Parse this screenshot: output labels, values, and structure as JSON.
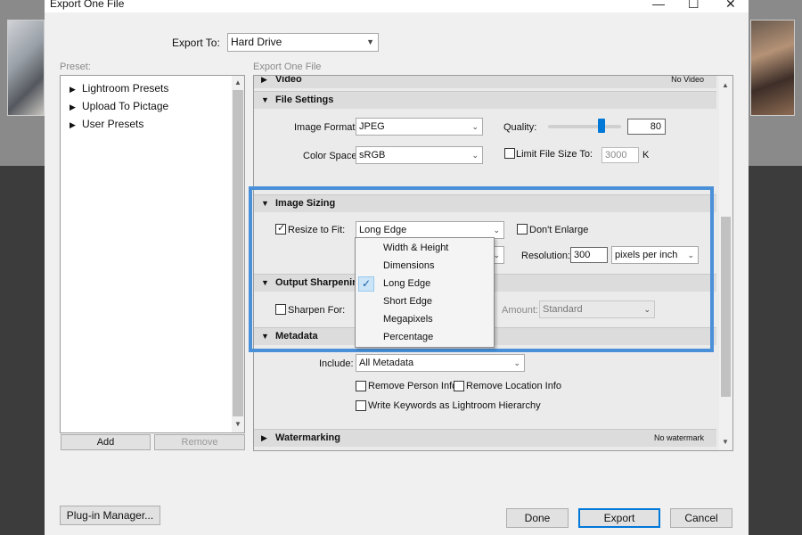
{
  "window": {
    "title": "Export One File",
    "minimize": "—",
    "maximize": "☐",
    "close": "✕"
  },
  "export_to": {
    "label": "Export To:",
    "value": "Hard Drive"
  },
  "preset": {
    "label": "Preset:",
    "items": [
      "Lightroom Presets",
      "Upload To Pictage",
      "User Presets"
    ],
    "add": "Add",
    "remove": "Remove"
  },
  "panel_label": "Export One File",
  "sections": {
    "video": {
      "title": "Video",
      "note": "No Video"
    },
    "file_settings": {
      "title": "File Settings",
      "image_format_label": "Image Format:",
      "image_format": "JPEG",
      "quality_label": "Quality:",
      "quality": "80",
      "quality_fraction": 0.8,
      "color_space_label": "Color Space:",
      "color_space": "sRGB",
      "limit_label": "Limit File Size To:",
      "limit_value": "3000",
      "limit_unit": "K"
    },
    "image_sizing": {
      "title": "Image Sizing",
      "resize_label": "Resize to Fit:",
      "resize_value": "Long Edge",
      "dont_enlarge": "Don't Enlarge",
      "resolution_label": "Resolution:",
      "resolution": "300",
      "resolution_unit": "pixels per inch"
    },
    "output_sharpening": {
      "title": "Output Sharpenin",
      "sharpen_label": "Sharpen For:",
      "amount_label": "Amount:",
      "amount": "Standard"
    },
    "metadata": {
      "title": "Metadata",
      "include_label": "Include:",
      "include": "All Metadata",
      "remove_person": "Remove Person Info",
      "remove_location": "Remove Location Info",
      "write_keywords": "Write Keywords as Lightroom Hierarchy"
    },
    "watermarking": {
      "title": "Watermarking",
      "note": "No watermark"
    }
  },
  "dropdown": {
    "items": [
      "Width & Height",
      "Dimensions",
      "Long Edge",
      "Short Edge",
      "Megapixels",
      "Percentage"
    ],
    "selected": "Long Edge"
  },
  "footer": {
    "plugin_manager": "Plug-in Manager...",
    "done": "Done",
    "export": "Export",
    "cancel": "Cancel"
  },
  "colors": {
    "highlight": "#4a90d9",
    "accent": "#0078d7"
  }
}
